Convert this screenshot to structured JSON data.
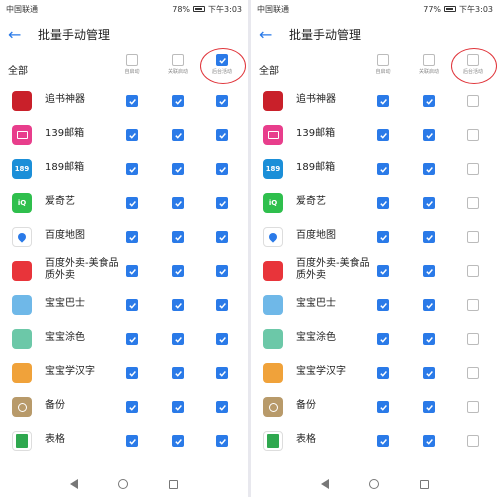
{
  "colors": {
    "accent": "#2a7ae8",
    "highlight": "#e0343a"
  },
  "panels": [
    {
      "status": {
        "carrier": "中国联通",
        "battery": "78%",
        "time": "下午3:03"
      },
      "header": {
        "title": "批量手动管理"
      },
      "all_label": "全部",
      "col_labels": [
        "自启动",
        "关联启动",
        "后台活动"
      ],
      "all_checked": [
        false,
        false,
        true
      ],
      "apps": [
        {
          "name": "追书神器",
          "icon": "book-app-icon",
          "color": "#c9202a",
          "checked": [
            true,
            true,
            true
          ]
        },
        {
          "name": "139邮箱",
          "icon": "mail-139-icon",
          "color": "#e83e8c",
          "checked": [
            true,
            true,
            true
          ]
        },
        {
          "name": "189邮箱",
          "icon": "mail-189-icon",
          "color": "#1b8fd8",
          "glyph": "189",
          "checked": [
            true,
            true,
            true
          ]
        },
        {
          "name": "爱奇艺",
          "icon": "iqiyi-icon",
          "color": "#2fbf4d",
          "glyph": "iQ",
          "checked": [
            true,
            true,
            true
          ]
        },
        {
          "name": "百度地图",
          "icon": "baidu-map-icon",
          "color": "#ffffff",
          "checked": [
            true,
            true,
            true
          ]
        },
        {
          "name": "百度外卖-美食品质外卖",
          "icon": "baidu-waimai-icon",
          "color": "#e8343a",
          "checked": [
            true,
            true,
            true
          ]
        },
        {
          "name": "宝宝巴士",
          "icon": "baby-bus-icon",
          "color": "#6fb8e8",
          "checked": [
            true,
            true,
            true
          ]
        },
        {
          "name": "宝宝涂色",
          "icon": "baby-coloring-icon",
          "color": "#6cc8a8",
          "checked": [
            true,
            true,
            true
          ]
        },
        {
          "name": "宝宝学汉字",
          "icon": "baby-hanzi-icon",
          "color": "#f0a23a",
          "checked": [
            true,
            true,
            true
          ]
        },
        {
          "name": "备份",
          "icon": "backup-icon",
          "color": "#b89a6a",
          "checked": [
            true,
            true,
            true
          ]
        },
        {
          "name": "表格",
          "icon": "sheets-icon",
          "color": "#ffffff",
          "checked": [
            true,
            true,
            true
          ]
        }
      ]
    },
    {
      "status": {
        "carrier": "中国联通",
        "battery": "77%",
        "time": "下午3:03"
      },
      "header": {
        "title": "批量手动管理"
      },
      "all_label": "全部",
      "col_labels": [
        "自启动",
        "关联启动",
        "后台活动"
      ],
      "all_checked": [
        false,
        false,
        false
      ],
      "apps": [
        {
          "name": "追书神器",
          "icon": "book-app-icon",
          "color": "#c9202a",
          "checked": [
            true,
            true,
            false
          ]
        },
        {
          "name": "139邮箱",
          "icon": "mail-139-icon",
          "color": "#e83e8c",
          "checked": [
            true,
            true,
            false
          ]
        },
        {
          "name": "189邮箱",
          "icon": "mail-189-icon",
          "color": "#1b8fd8",
          "glyph": "189",
          "checked": [
            true,
            true,
            false
          ]
        },
        {
          "name": "爱奇艺",
          "icon": "iqiyi-icon",
          "color": "#2fbf4d",
          "glyph": "iQ",
          "checked": [
            true,
            true,
            false
          ]
        },
        {
          "name": "百度地图",
          "icon": "baidu-map-icon",
          "color": "#ffffff",
          "checked": [
            true,
            true,
            false
          ]
        },
        {
          "name": "百度外卖-美食品质外卖",
          "icon": "baidu-waimai-icon",
          "color": "#e8343a",
          "checked": [
            true,
            true,
            false
          ]
        },
        {
          "name": "宝宝巴士",
          "icon": "baby-bus-icon",
          "color": "#6fb8e8",
          "checked": [
            true,
            true,
            false
          ]
        },
        {
          "name": "宝宝涂色",
          "icon": "baby-coloring-icon",
          "color": "#6cc8a8",
          "checked": [
            true,
            true,
            false
          ]
        },
        {
          "name": "宝宝学汉字",
          "icon": "baby-hanzi-icon",
          "color": "#f0a23a",
          "checked": [
            true,
            true,
            false
          ]
        },
        {
          "name": "备份",
          "icon": "backup-icon",
          "color": "#b89a6a",
          "checked": [
            true,
            true,
            false
          ]
        },
        {
          "name": "表格",
          "icon": "sheets-icon",
          "color": "#ffffff",
          "checked": [
            true,
            true,
            false
          ]
        }
      ]
    }
  ]
}
